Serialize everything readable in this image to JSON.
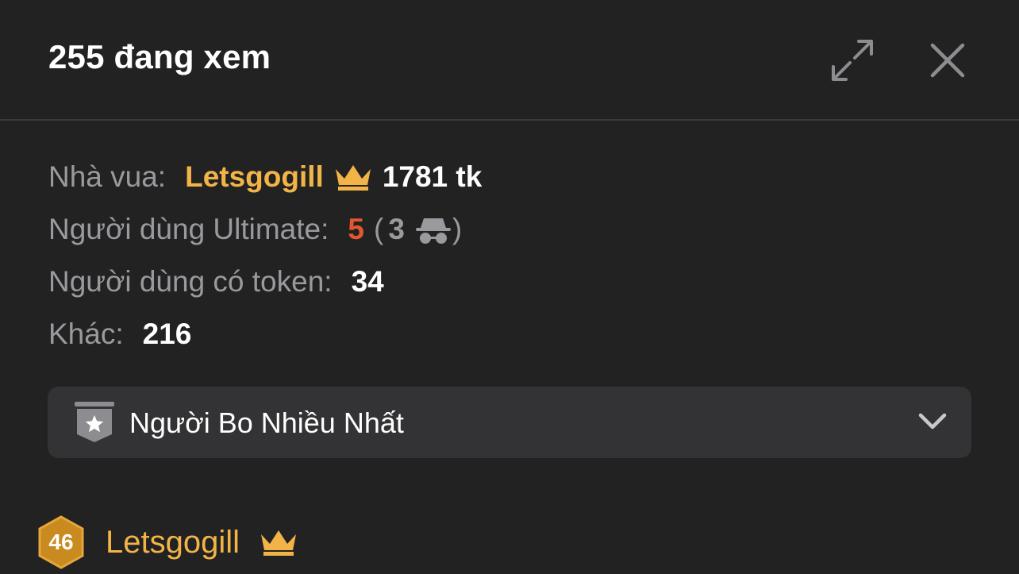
{
  "header": {
    "title": "255 đang xem",
    "expand_icon": "expand-icon",
    "close_icon": "close-icon"
  },
  "stats": {
    "king_label": "Nhà vua:",
    "king_name": "Letsgogill",
    "king_tokens": "1781 tk",
    "ultimate_label": "Người dùng Ultimate:",
    "ultimate_count": "5",
    "ultimate_paren_open": "(",
    "ultimate_hidden": "3",
    "ultimate_paren_close": ")",
    "token_label": "Người dùng có token:",
    "token_count": "34",
    "other_label": "Khác:",
    "other_count": "216"
  },
  "dropdown": {
    "label": "Người Bo Nhiều Nhất",
    "icon": "star-shield-icon",
    "chevron": "chevron-down-icon"
  },
  "list": {
    "items": [
      {
        "level": "46",
        "name": "Letsgogill",
        "icon": "crown-icon"
      }
    ]
  },
  "colors": {
    "background": "#222223",
    "gold": "#f2b447",
    "ultimate_red": "#e4572e",
    "muted": "#9a9a9e",
    "dropdown_bg": "#333335"
  }
}
